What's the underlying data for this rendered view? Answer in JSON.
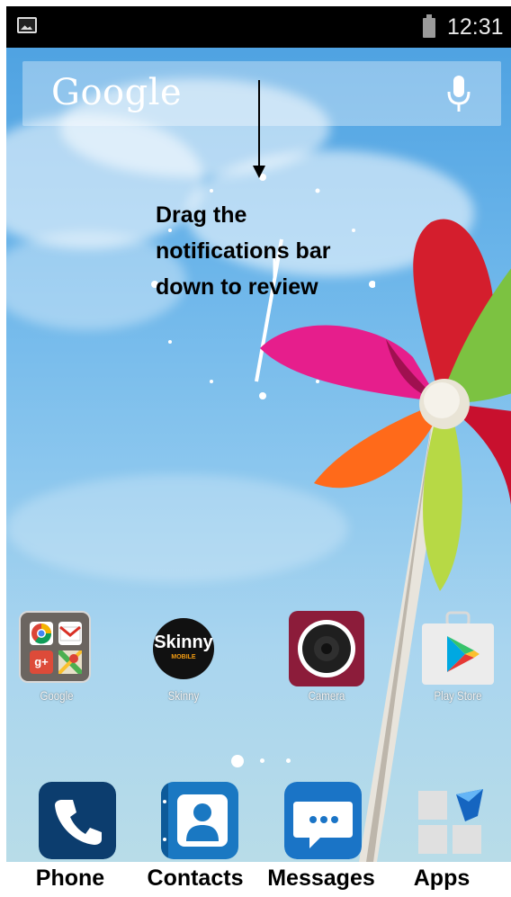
{
  "status_bar": {
    "time": "12:31",
    "icons": [
      "gallery-notification-icon",
      "battery-icon"
    ]
  },
  "search_widget": {
    "logo_text": "Google",
    "icon": "mic-icon"
  },
  "annotation": {
    "lines": [
      "Drag the",
      "notifications bar",
      "down to review"
    ]
  },
  "home_apps": [
    {
      "label": "Google",
      "icon": "google-folder-icon"
    },
    {
      "label": "Skinny",
      "icon": "skinny-icon",
      "icon_text": "Skinny",
      "icon_subtext": "MOBILE"
    },
    {
      "label": "Camera",
      "icon": "camera-icon"
    },
    {
      "label": "Play Store",
      "icon": "play-store-icon"
    }
  ],
  "page_indicator": {
    "pages": 3,
    "current": 1
  },
  "dock": [
    {
      "label": "Phone",
      "icon": "phone-icon",
      "color": "#0c3d6e"
    },
    {
      "label": "Contacts",
      "icon": "contacts-icon",
      "color": "#1a78c2"
    },
    {
      "label": "Messages",
      "icon": "messages-icon",
      "color": "#1a74c6"
    },
    {
      "label": "Apps",
      "icon": "apps-grid-icon"
    }
  ]
}
